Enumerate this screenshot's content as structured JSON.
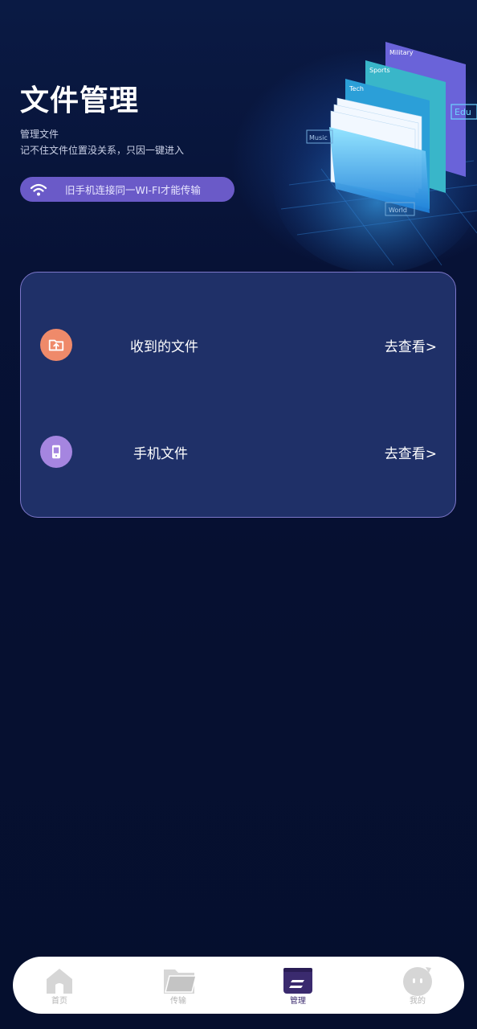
{
  "header": {
    "title": "文件管理",
    "subtitle": "管理文件",
    "description": "记不住文件位置没关系，只因一键进入"
  },
  "notice": {
    "text": "旧手机连接同一WI-FI才能传输",
    "icon": "wifi-icon"
  },
  "hero_labels": [
    "Military",
    "Sports",
    "Tech",
    "Edu",
    "Music",
    "World"
  ],
  "entries": [
    {
      "title": "收到的文件",
      "action": "去查看>",
      "icon": "received-folder-icon",
      "color": "#ef8a6a"
    },
    {
      "title": "手机文件",
      "action": "去查看>",
      "icon": "phone-icon",
      "color": "#a585e0"
    }
  ],
  "tabs": [
    {
      "label": "首页",
      "icon": "home-icon",
      "active": false
    },
    {
      "label": "传输",
      "icon": "folder-icon",
      "active": false
    },
    {
      "label": "管理",
      "icon": "manage-icon",
      "active": true
    },
    {
      "label": "我的",
      "icon": "profile-icon",
      "active": false
    }
  ],
  "colors": {
    "background": "#071132",
    "card": "#1f3068",
    "card_border": "#7c76c9",
    "pill": "#6a5ac8",
    "active_tab": "#3a2a6e"
  }
}
